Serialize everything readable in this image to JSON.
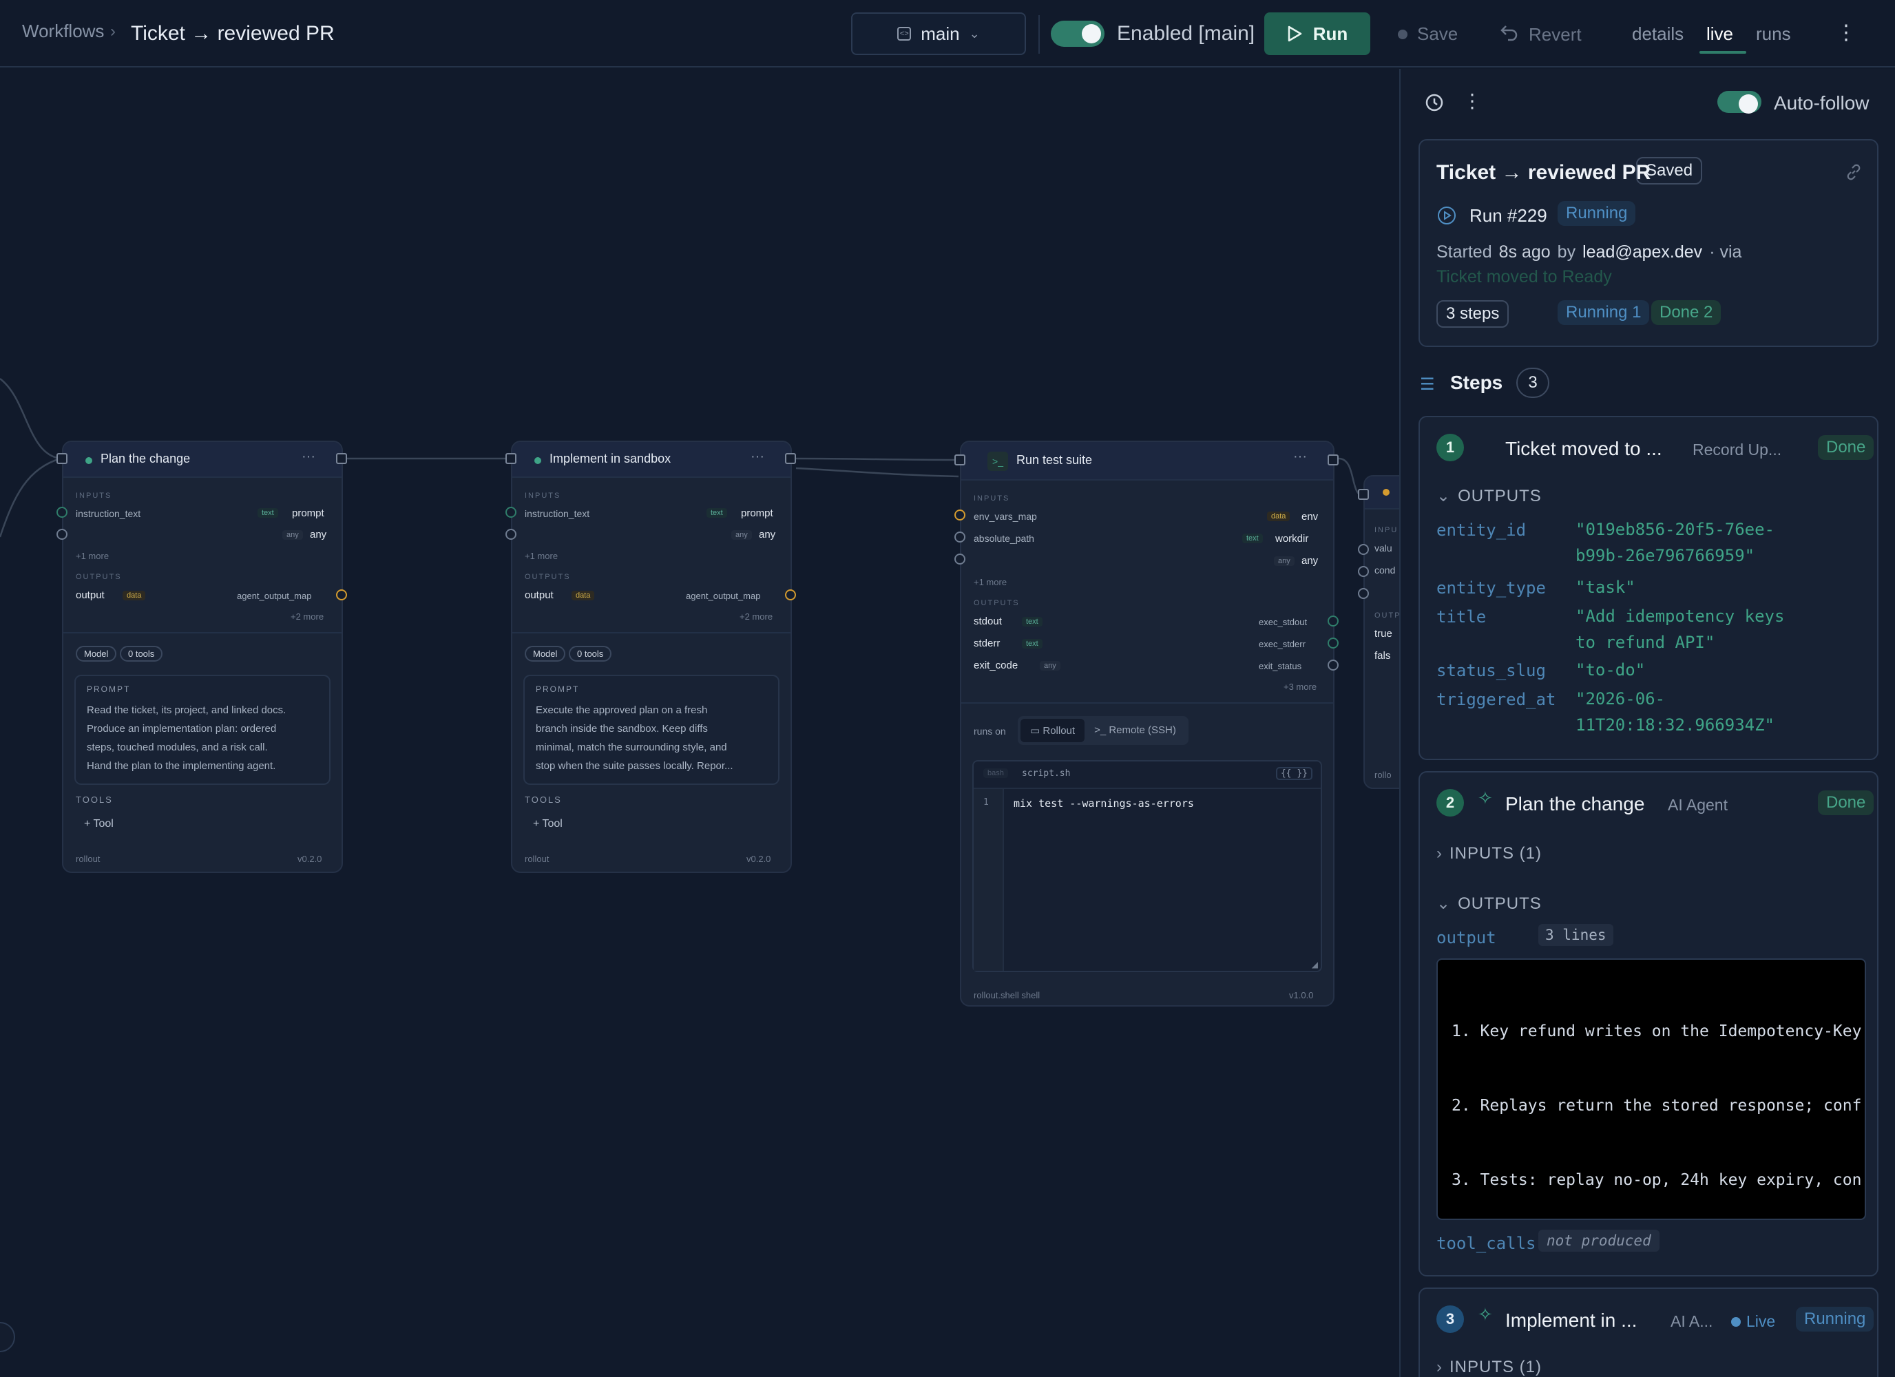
{
  "topbar": {
    "breadcrumb": "Workflows",
    "separator": "›",
    "title": "Ticket → reviewed PR",
    "branch": "main",
    "enabled_label": "Enabled [main]",
    "run_label": "Run",
    "save_label": "Save",
    "revert_label": "Revert",
    "tabs": [
      "details",
      "live",
      "runs"
    ],
    "active_tab": "live"
  },
  "colors": {
    "accent": "#2f7d6a",
    "running": "#4f8fc4",
    "done": "#47a689",
    "data_tag": "#d2b04a",
    "bg": "#111a2b"
  },
  "nodes": {
    "plan": {
      "title": "Plan the change",
      "inputs_label": "INPUTS",
      "in1_name": "instruction_text",
      "in1_tag": "text",
      "in1_target": "prompt",
      "in2_tag": "any",
      "in2_target": "any",
      "more_in": "+1 more",
      "outputs_label": "OUTPUTS",
      "out1_name": "output",
      "out1_tag": "data",
      "out1_target": "agent_output_map",
      "more_out": "+2 more",
      "pill_model": "Model",
      "pill_tools": "0 tools",
      "prompt_label": "PROMPT",
      "prompt_lines": [
        "Read the ticket, its project, and linked docs.",
        "Produce an implementation plan: ordered",
        "steps, touched modules, and a risk call.",
        "Hand the plan to the implementing agent."
      ],
      "tools_label": "TOOLS",
      "tool_add": "+  Tool",
      "footer_left": "rollout",
      "footer_right": "v0.2.0"
    },
    "implement": {
      "title": "Implement in sandbox",
      "inputs_label": "INPUTS",
      "in1_name": "instruction_text",
      "in1_tag": "text",
      "in1_target": "prompt",
      "in2_tag": "any",
      "in2_target": "any",
      "more_in": "+1 more",
      "outputs_label": "OUTPUTS",
      "out1_name": "output",
      "out1_tag": "data",
      "out1_target": "agent_output_map",
      "more_out": "+2 more",
      "pill_model": "Model",
      "pill_tools": "0 tools",
      "prompt_label": "PROMPT",
      "prompt_lines": [
        "Execute the approved plan on a fresh",
        "branch inside the sandbox. Keep diffs",
        "minimal, match the surrounding style, and",
        "stop when the suite passes locally. Repor..."
      ],
      "tools_label": "TOOLS",
      "tool_add": "+  Tool",
      "footer_left": "rollout",
      "footer_right": "v0.2.0"
    },
    "tests": {
      "title": "Run test suite",
      "inputs_label": "INPUTS",
      "in1_name": "env_vars_map",
      "in1_tag": "data",
      "in1_target": "env",
      "in2_name": "absolute_path",
      "in2_tag": "text",
      "in2_target": "workdir",
      "in3_tag": "any",
      "in3_target": "any",
      "more_in": "+1 more",
      "outputs_label": "OUTPUTS",
      "out1_name": "stdout",
      "out1_tag": "text",
      "out1_target": "exec_stdout",
      "out2_name": "stderr",
      "out2_tag": "text",
      "out2_target": "exec_stderr",
      "out3_name": "exit_code",
      "out3_tag": "any",
      "out3_target": "exit_status",
      "more_out": "+3 more",
      "runs_on_label": "runs on",
      "runs_on_options": [
        "Rollout",
        "Remote (SSH)"
      ],
      "runs_on_selected": "Rollout",
      "code_lang": "bash",
      "code_file": "script.sh",
      "code_vars": "{{ }}",
      "code_line_no": "1",
      "code_line": "mix test --warnings-as-errors",
      "footer_left": "rollout.shell  shell",
      "footer_right": "v1.0.0"
    },
    "partial": {
      "inputs_label": "INPU",
      "in1": "valu",
      "in2": "cond",
      "outputs_label": "OUTP",
      "out1": "true",
      "out2": "fals",
      "footer": "rollo"
    }
  },
  "panel": {
    "auto_follow_label": "Auto-follow",
    "workflow_title": "Ticket → reviewed PR",
    "saved_badge": "Saved",
    "run_label": "Run #229",
    "run_status": "Running",
    "started_prefix": "Started",
    "started_ago": "8s ago",
    "by_label": "by",
    "started_by": "lead@apex.dev",
    "via_label": "·  via",
    "trigger": "Ticket moved to Ready",
    "chip_steps": "3 steps",
    "chip_running": "Running 1",
    "chip_done": "Done 2",
    "steps_title": "Steps",
    "steps_count": "3",
    "steps": [
      {
        "num": "1",
        "title": "Ticket moved to ...",
        "subtitle": "Record Up...",
        "status": "Done",
        "outputs_label": "OUTPUTS",
        "outputs": [
          {
            "key": "entity_id",
            "lines": [
              "\"019eb856-20f5-76ee-",
              "b99b-26e796766959\""
            ]
          },
          {
            "key": "entity_type",
            "lines": [
              "\"task\""
            ]
          },
          {
            "key": "title",
            "lines": [
              "\"Add idempotency keys",
              "to refund API\""
            ]
          },
          {
            "key": "status_slug",
            "lines": [
              "\"to-do\""
            ]
          },
          {
            "key": "triggered_at",
            "lines": [
              "\"2026-06-",
              "11T20:18:32.966934Z\""
            ]
          }
        ]
      },
      {
        "num": "2",
        "title": "Plan the change",
        "subtitle": "AI Agent",
        "status": "Done",
        "inputs_label": "INPUTS (1)",
        "outputs_label": "OUTPUTS",
        "output_key": "output",
        "output_lines_badge": "3 lines",
        "output_lines": [
          "1. Key refund writes on the Idempotency-Key",
          "2. Replays return the stored response; conf",
          "3. Tests: replay no-op, 24h key expiry, con"
        ],
        "tool_calls_key": "tool_calls",
        "tool_calls_value": "not produced"
      },
      {
        "num": "3",
        "title": "Implement in ...",
        "subtitle": "AI A...",
        "live_label": "Live",
        "status": "Running",
        "inputs_label": "INPUTS (1)"
      }
    ]
  }
}
